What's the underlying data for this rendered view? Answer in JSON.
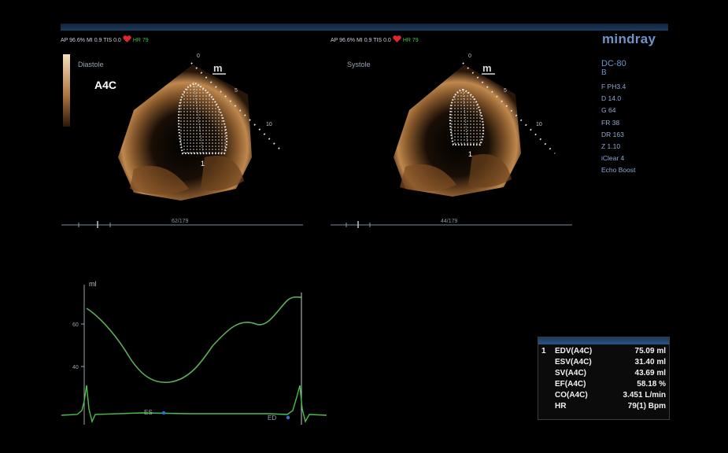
{
  "vendor": {
    "logo": "mindray",
    "model": "DC-80",
    "mode": "B"
  },
  "left_status": {
    "ap": "AP 96.6%",
    "mi": "MI 0.9",
    "tis": "TIS 0.0",
    "hr": "HR 79"
  },
  "right_status": {
    "ap": "AP 96.6%",
    "mi": "MI 0.9",
    "tis": "TIS 0.0",
    "hr": "HR 79"
  },
  "params": [
    "F PH3.4",
    "D 14.0",
    "G 64",
    "FR 38",
    "DR 163",
    "Z 1.10",
    "iClear 4",
    "Echo Boost"
  ],
  "left_image": {
    "phase": "Diastole",
    "view": "A4C",
    "frame_counter": "62/179",
    "depth_marks": [
      "0",
      "5",
      "10"
    ],
    "marker": "1"
  },
  "right_image": {
    "phase": "Systole",
    "frame_counter": "44/179",
    "depth_marks": [
      "0",
      "5",
      "10"
    ],
    "marker": "1"
  },
  "volume_curve": {
    "unit": "ml",
    "ticks": [
      "60",
      "40"
    ],
    "es_label": "ES",
    "ed_label": "ED",
    "curve_color": "#5fae57"
  },
  "results": {
    "index": "1",
    "rows": [
      {
        "label": "EDV(A4C)",
        "value": "75.09 ml"
      },
      {
        "label": "ESV(A4C)",
        "value": "31.40 ml"
      },
      {
        "label": "SV(A4C)",
        "value": "43.69 ml"
      },
      {
        "label": "EF(A4C)",
        "value": "58.18 %"
      },
      {
        "label": "CO(A4C)",
        "value": "3.451 L/min"
      },
      {
        "label": "HR",
        "value": "79(1) Bpm"
      }
    ]
  },
  "colors": {
    "accent": "#6e94c8",
    "ecg_green": "#4bbf4b",
    "heart_red": "#e0262a"
  }
}
